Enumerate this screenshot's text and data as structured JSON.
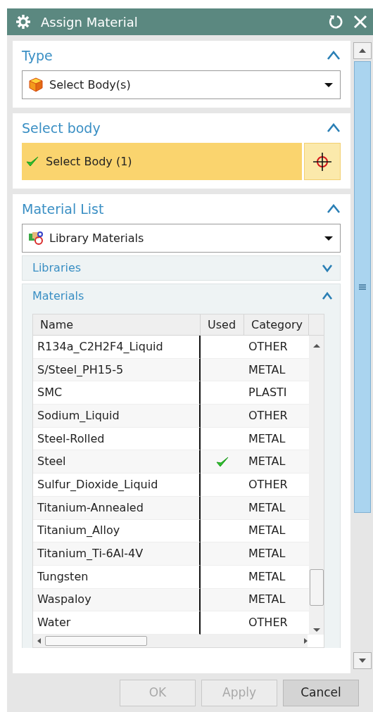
{
  "window": {
    "title": "Assign Material"
  },
  "type_section": {
    "title": "Type",
    "expanded": true,
    "dropdown": {
      "value": "Select Body(s)"
    }
  },
  "select_body_section": {
    "title": "Select body",
    "expanded": true,
    "selector": {
      "label": "Select Body (1)",
      "done": true
    }
  },
  "material_list_section": {
    "title": "Material List",
    "expanded": true,
    "dropdown": {
      "value": "Library Materials"
    },
    "subsections": [
      {
        "title": "Libraries",
        "expanded": false
      },
      {
        "title": "Materials",
        "expanded": true
      }
    ],
    "table": {
      "columns": [
        "Name",
        "Used",
        "Category"
      ],
      "rows": [
        {
          "name": "R134a_C2H2F4_Liquid",
          "used": false,
          "category": "OTHER"
        },
        {
          "name": "S/Steel_PH15-5",
          "used": false,
          "category": "METAL"
        },
        {
          "name": "SMC",
          "used": false,
          "category": "PLASTI"
        },
        {
          "name": "Sodium_Liquid",
          "used": false,
          "category": "OTHER"
        },
        {
          "name": "Steel-Rolled",
          "used": false,
          "category": "METAL"
        },
        {
          "name": "Steel",
          "used": true,
          "category": "METAL"
        },
        {
          "name": "Sulfur_Dioxide_Liquid",
          "used": false,
          "category": "OTHER"
        },
        {
          "name": "Titanium-Annealed",
          "used": false,
          "category": "METAL"
        },
        {
          "name": "Titanium_Alloy",
          "used": false,
          "category": "METAL"
        },
        {
          "name": "Titanium_Ti-6Al-4V",
          "used": false,
          "category": "METAL"
        },
        {
          "name": "Tungsten",
          "used": false,
          "category": "METAL"
        },
        {
          "name": "Waspaloy",
          "used": false,
          "category": "METAL"
        },
        {
          "name": "Water",
          "used": false,
          "category": "OTHER"
        }
      ]
    }
  },
  "buttons": [
    {
      "label": "OK",
      "disabled": true
    },
    {
      "label": "Apply",
      "disabled": true
    },
    {
      "label": "Cancel",
      "disabled": false
    }
  ]
}
